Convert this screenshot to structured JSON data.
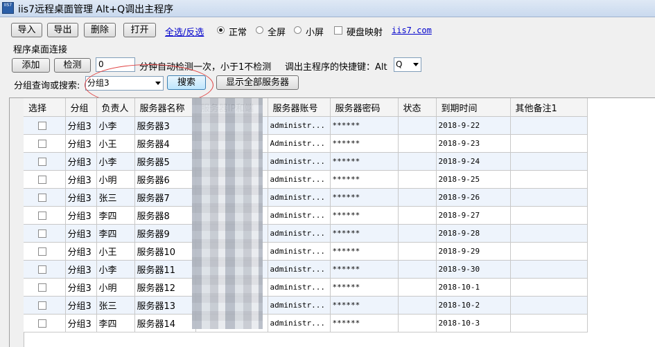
{
  "window": {
    "title": "iis7远程桌面管理 Alt+Q调出主程序",
    "icon_text": "IIS7"
  },
  "toolbar": {
    "import": "导入",
    "export": "导出",
    "delete": "删除",
    "open": "打开",
    "select_all": "全选/反选",
    "mode_options": [
      "正常",
      "全屏",
      "小屏"
    ],
    "mode_selected": "正常",
    "disk_map": "硬盘映射",
    "disk_map_checked": false,
    "site_link": "iis7.com"
  },
  "connect": {
    "section_title": "程序桌面连接",
    "add": "添加",
    "check": "检测",
    "interval_value": "0",
    "interval_text": "分钟自动检测一次，小于1不检测",
    "hotkey_label": "调出主程序的快捷键：Alt",
    "hotkey_value": "Q"
  },
  "search": {
    "label": "分组查询或搜索:",
    "value": "分组3",
    "search_button": "搜索",
    "show_all_button": "显示全部服务器"
  },
  "table": {
    "headers": [
      "选择",
      "分组",
      "负责人",
      "服务器名称",
      "服务器IP和端",
      "服务器账号",
      "服务器密码",
      "状态",
      "到期时间",
      "其他备注1"
    ],
    "rows": [
      {
        "group": "分组3",
        "owner": "小李",
        "name": "服务器3",
        "ip": "",
        "account": "administr...",
        "password": "******",
        "status": "",
        "expire": "2018-9-22",
        "note": ""
      },
      {
        "group": "分组3",
        "owner": "小王",
        "name": "服务器4",
        "ip": "",
        "account": "Administr...",
        "password": "******",
        "status": "",
        "expire": "2018-9-23",
        "note": ""
      },
      {
        "group": "分组3",
        "owner": "小李",
        "name": "服务器5",
        "ip": "",
        "account": "administr...",
        "password": "******",
        "status": "",
        "expire": "2018-9-24",
        "note": ""
      },
      {
        "group": "分组3",
        "owner": "小明",
        "name": "服务器6",
        "ip": "",
        "account": "administr...",
        "password": "******",
        "status": "",
        "expire": "2018-9-25",
        "note": ""
      },
      {
        "group": "分组3",
        "owner": "张三",
        "name": "服务器7",
        "ip": "",
        "account": "administr...",
        "password": "******",
        "status": "",
        "expire": "2018-9-26",
        "note": ""
      },
      {
        "group": "分组3",
        "owner": "李四",
        "name": "服务器8",
        "ip": "",
        "account": "administr...",
        "password": "******",
        "status": "",
        "expire": "2018-9-27",
        "note": ""
      },
      {
        "group": "分组3",
        "owner": "李四",
        "name": "服务器9",
        "ip": "",
        "account": "administr...",
        "password": "******",
        "status": "",
        "expire": "2018-9-28",
        "note": ""
      },
      {
        "group": "分组3",
        "owner": "小王",
        "name": "服务器10",
        "ip": "",
        "account": "administr...",
        "password": "******",
        "status": "",
        "expire": "2018-9-29",
        "note": ""
      },
      {
        "group": "分组3",
        "owner": "小李",
        "name": "服务器11",
        "ip": "",
        "account": "administr...",
        "password": "******",
        "status": "",
        "expire": "2018-9-30",
        "note": ""
      },
      {
        "group": "分组3",
        "owner": "小明",
        "name": "服务器12",
        "ip": "",
        "account": "administr...",
        "password": "******",
        "status": "",
        "expire": "2018-10-1",
        "note": ""
      },
      {
        "group": "分组3",
        "owner": "张三",
        "name": "服务器13",
        "ip": "",
        "account": "administr...",
        "password": "******",
        "status": "",
        "expire": "2018-10-2",
        "note": ""
      },
      {
        "group": "分组3",
        "owner": "李四",
        "name": "服务器14",
        "ip": "",
        "account": "administr...",
        "password": "******",
        "status": "",
        "expire": "2018-10-3",
        "note": ""
      }
    ]
  },
  "colors": {
    "link": "#0000cc",
    "row_alt": "#eef4fc",
    "highlight_ellipse": "#e04040"
  }
}
